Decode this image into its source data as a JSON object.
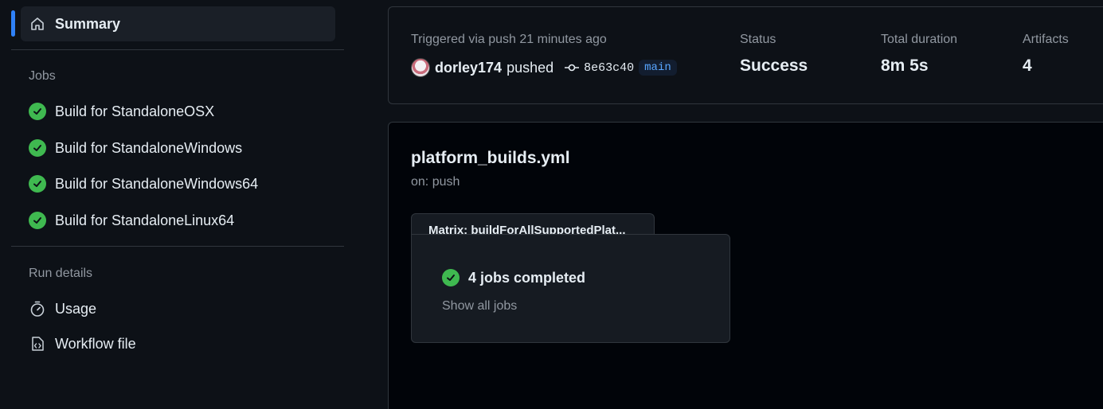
{
  "sidebar": {
    "summary_label": "Summary",
    "jobs_title": "Jobs",
    "jobs": [
      {
        "label": "Build for StandaloneOSX",
        "status": "success"
      },
      {
        "label": "Build for StandaloneWindows",
        "status": "success"
      },
      {
        "label": "Build for StandaloneWindows64",
        "status": "success"
      },
      {
        "label": "Build for StandaloneLinux64",
        "status": "success"
      }
    ],
    "run_details_title": "Run details",
    "usage_label": "Usage",
    "workflow_file_label": "Workflow file"
  },
  "run": {
    "triggered": "Triggered via push 21 minutes ago",
    "user": "dorley174",
    "action": "pushed",
    "commit": "8e63c40",
    "branch": "main",
    "status_label": "Status",
    "status_value": "Success",
    "duration_label": "Total duration",
    "duration_value": "8m 5s",
    "artifacts_label": "Artifacts",
    "artifacts_value": "4"
  },
  "workflow": {
    "file": "platform_builds.yml",
    "trigger": "on: push",
    "matrix_title": "Matrix: buildForAllSupportedPlat...",
    "jobs_completed": "4 jobs completed",
    "show_all": "Show all jobs"
  },
  "colors": {
    "accent": "#2f81f7",
    "success": "#3fb950",
    "background": "#0d1117"
  }
}
